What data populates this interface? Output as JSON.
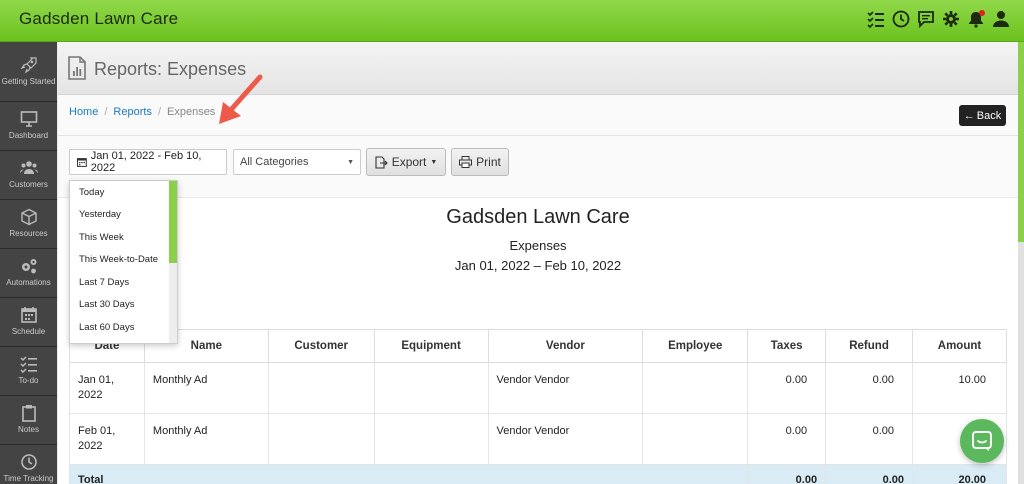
{
  "app": {
    "title": "Gadsden Lawn Care"
  },
  "top_icons": [
    "checklist-icon",
    "clock-icon",
    "chat-icon",
    "gear-icon",
    "bell-icon",
    "user-icon"
  ],
  "sidebar": {
    "items": [
      {
        "label": "Getting Started",
        "icon": "rocket-icon"
      },
      {
        "label": "Dashboard",
        "icon": "monitor-icon"
      },
      {
        "label": "Customers",
        "icon": "users-icon"
      },
      {
        "label": "Resources",
        "icon": "box-icon"
      },
      {
        "label": "Automations",
        "icon": "gears-icon"
      },
      {
        "label": "Schedule",
        "icon": "calendar-icon"
      },
      {
        "label": "To-do",
        "icon": "checklist-icon"
      },
      {
        "label": "Notes",
        "icon": "clipboard-icon"
      },
      {
        "label": "Time Tracking",
        "icon": "clock-icon"
      }
    ]
  },
  "page": {
    "title": "Reports: Expenses"
  },
  "breadcrumb": {
    "home": "Home",
    "reports": "Reports",
    "current": "Expenses"
  },
  "back_label": "Back",
  "toolbar": {
    "date_range": "Jan 01, 2022 - Feb 10, 2022",
    "category": "All Categories",
    "export_label": "Export",
    "print_label": "Print"
  },
  "dropdown": {
    "options": [
      "Today",
      "Yesterday",
      "This Week",
      "This Week-to-Date",
      "Last 7 Days",
      "Last 30 Days",
      "Last 60 Days"
    ]
  },
  "report": {
    "company": "Gadsden Lawn Care",
    "subtitle": "Expenses",
    "range": "Jan 01, 2022 – Feb 10, 2022",
    "columns": [
      "Date",
      "Name",
      "Customer",
      "Equipment",
      "Vendor",
      "Employee",
      "Taxes",
      "Refund",
      "Amount"
    ],
    "rows": [
      {
        "date": "Jan 01, 2022",
        "name": "Monthly Ad",
        "customer": "",
        "equipment": "",
        "vendor": "Vendor Vendor",
        "employee": "",
        "taxes": "0.00",
        "refund": "0.00",
        "amount": "10.00"
      },
      {
        "date": "Feb 01, 2022",
        "name": "Monthly Ad",
        "customer": "",
        "equipment": "",
        "vendor": "Vendor Vendor",
        "employee": "",
        "taxes": "0.00",
        "refund": "0.00",
        "amount": ""
      }
    ],
    "total": {
      "label": "Total",
      "taxes": "0.00",
      "refund": "0.00",
      "amount": "20.00"
    }
  },
  "colors": {
    "brand_green": "#7ccc2e",
    "link": "#1a7ac0",
    "arrow": "#ee5a4a",
    "chat": "#5cb85c",
    "total_row": "#d9ecf5"
  }
}
